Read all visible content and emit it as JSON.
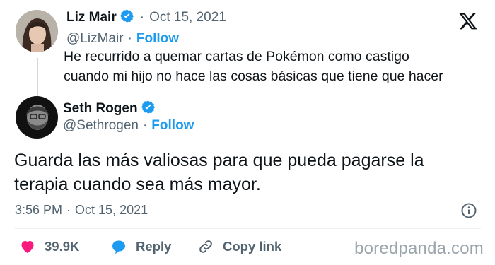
{
  "quoted_tweet": {
    "author_name": "Liz Mair",
    "handle": "@LizMair",
    "separator": "·",
    "date": "Oct 15, 2021",
    "follow_label": "Follow",
    "text_line1": "He recurrido a quemar cartas de Pokémon como castigo",
    "text_line2": "cuando mi hijo no hace las cosas básicas que tiene que hacer"
  },
  "main_tweet": {
    "author_name": "Seth Rogen",
    "handle": "@Sethrogen",
    "separator": "·",
    "follow_label": "Follow",
    "text_line1": "Guarda las más valiosas para que pueda pagarse la",
    "text_line2": "terapia cuando sea más mayor.",
    "time": "3:56 PM",
    "date": "Oct 15, 2021"
  },
  "actions": {
    "likes_count": "39.9K",
    "reply_label": "Reply",
    "copy_link_label": "Copy link"
  },
  "watermark": "boredpanda.com",
  "colors": {
    "accent": "#1d9bf0",
    "like": "#f91880",
    "text": "#0f1419",
    "muted": "#536471"
  },
  "icons": {
    "verified": "verified-badge-icon",
    "platform": "x-logo-icon",
    "info": "info-icon",
    "like": "heart-icon",
    "reply": "reply-bubble-icon",
    "copy_link": "link-icon"
  }
}
